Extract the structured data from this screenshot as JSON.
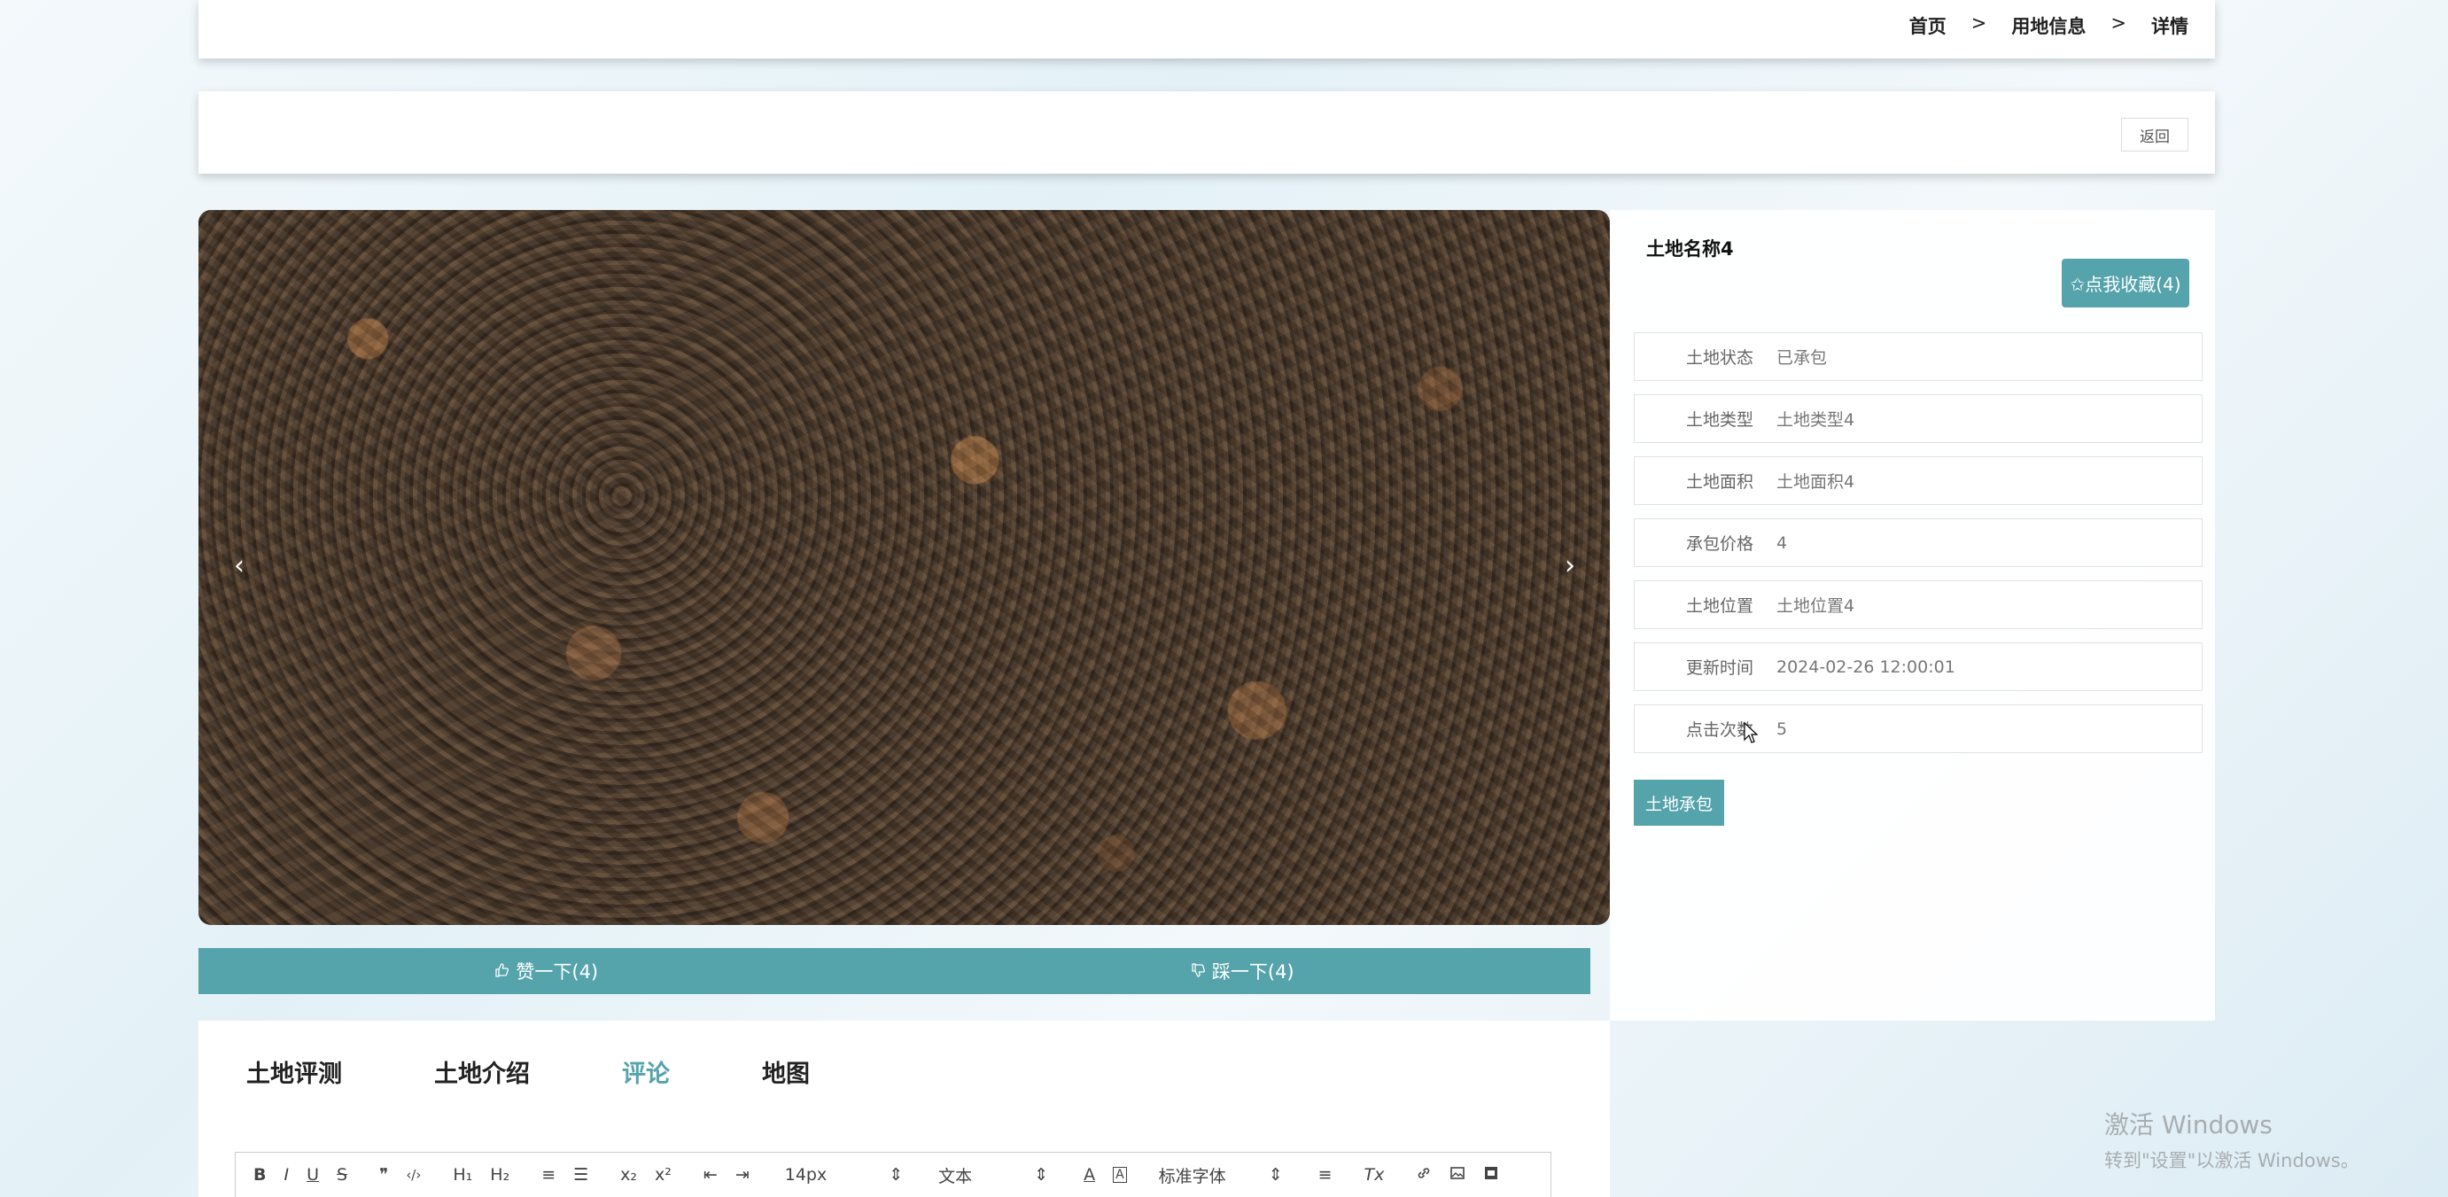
{
  "breadcrumb": {
    "home": "首页",
    "sep": ">",
    "section": "用地信息",
    "current": "详情"
  },
  "action": {
    "back_label": "返回"
  },
  "carousel": {
    "prev": "‹",
    "next": "›"
  },
  "votes": {
    "like": "赞一下(4)",
    "dislike": "踩一下(4)"
  },
  "info": {
    "name": "土地名称4",
    "fav_label": "✩点我收藏(4)",
    "rows": [
      {
        "label": "土地状态",
        "value": "已承包"
      },
      {
        "label": "土地类型",
        "value": "土地类型4"
      },
      {
        "label": "土地面积",
        "value": "土地面积4"
      },
      {
        "label": "承包价格",
        "value": "4"
      },
      {
        "label": "土地位置",
        "value": "土地位置4"
      },
      {
        "label": "更新时间",
        "value": "2024-02-26 12:00:01"
      },
      {
        "label": "点击次数",
        "value": "5"
      }
    ],
    "contract_label": "土地承包"
  },
  "tabs": [
    "土地评测",
    "土地介绍",
    "评论",
    "地图"
  ],
  "editor": {
    "bold": "B",
    "italic": "I",
    "underline": "U",
    "strike": "S",
    "quote": "❞",
    "code": "‹/›",
    "h1": "H₁",
    "h2": "H₂",
    "ol": "≡",
    "ul": "☰",
    "sub": "x₂",
    "sup": "x²",
    "outdent": "⇤",
    "indent": "⇥",
    "size": "14px",
    "header": "文本",
    "font": "标准字体",
    "align": "≡",
    "clean": "Tx"
  },
  "watermark": {
    "line1": "激活 Windows",
    "line2": "转到\"设置\"以激活 Windows。"
  },
  "colors": {
    "accent": "#55a3ab"
  }
}
